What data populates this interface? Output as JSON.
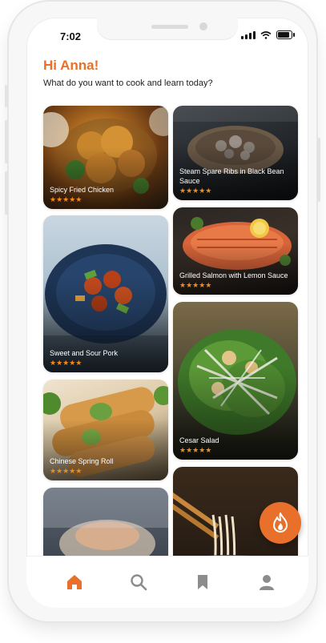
{
  "status_bar": {
    "time": "7:02"
  },
  "header": {
    "greeting": "Hi Anna!",
    "subtitle": "What do you want to cook and learn today?"
  },
  "recipes": [
    {
      "title": "Spicy Fried Chicken",
      "stars": "★★★★★"
    },
    {
      "title": "Steam Spare Ribs in Black Bean Sauce",
      "stars": "★★★★★"
    },
    {
      "title": "Grilled Salmon with Lemon Sauce",
      "stars": "★★★★★"
    },
    {
      "title": "Sweet and Sour Pork",
      "stars": "★★★★★"
    },
    {
      "title": "Cesar Salad",
      "stars": "★★★★★"
    },
    {
      "title": "Chinese Spring Roll",
      "stars": "★★★★★"
    }
  ],
  "fab": {
    "icon": "flame-icon"
  },
  "tabs": [
    {
      "icon": "home-icon",
      "active": true
    },
    {
      "icon": "search-icon",
      "active": false
    },
    {
      "icon": "bookmark-icon",
      "active": false
    },
    {
      "icon": "profile-icon",
      "active": false
    }
  ],
  "colors": {
    "accent": "#e8702a",
    "star": "#f28a1c",
    "inactive_icon": "#8c8c8c"
  }
}
